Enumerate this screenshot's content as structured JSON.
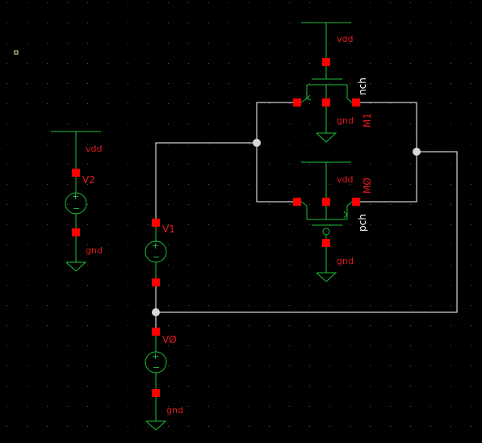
{
  "labels": {
    "vdd": "vdd",
    "gnd": "gnd",
    "nch": "nch",
    "pch": "pch",
    "m1": "M1",
    "m0": "MØ",
    "v0": "VØ",
    "v1": "V1",
    "v2": "V2"
  },
  "colors": {
    "background": "#000000",
    "grid_dot": "#5a5a5a",
    "symbol": "#1cbf3a",
    "wire": "#ffffff",
    "pin": "#ff0000",
    "label": "#e0191f",
    "cell_label": "#ffffff"
  }
}
